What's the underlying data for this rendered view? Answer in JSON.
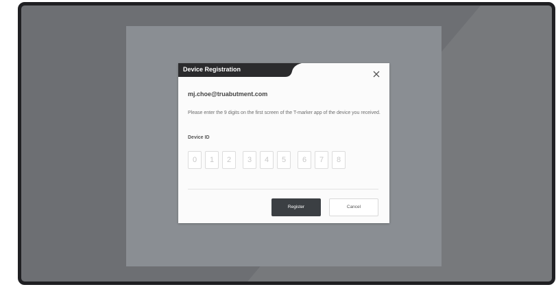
{
  "dialog": {
    "title": "Device Registration",
    "email": "mj.choe@truabutment.com",
    "instruction": "Please enter the 9 digits on the first screen of the T-marker app of the device you received.",
    "device_id_label": "Device ID",
    "digit_placeholders": [
      "0",
      "1",
      "2",
      "3",
      "4",
      "5",
      "6",
      "7",
      "8"
    ],
    "register_label": "Register",
    "cancel_label": "Cancel",
    "close_icon": "close-icon"
  },
  "colors": {
    "frame": "#1f1f22",
    "background": "#6d6f73",
    "screen": "#8a8e93",
    "title_bar": "#2b2b2d",
    "primary_button": "#3b3f43"
  }
}
